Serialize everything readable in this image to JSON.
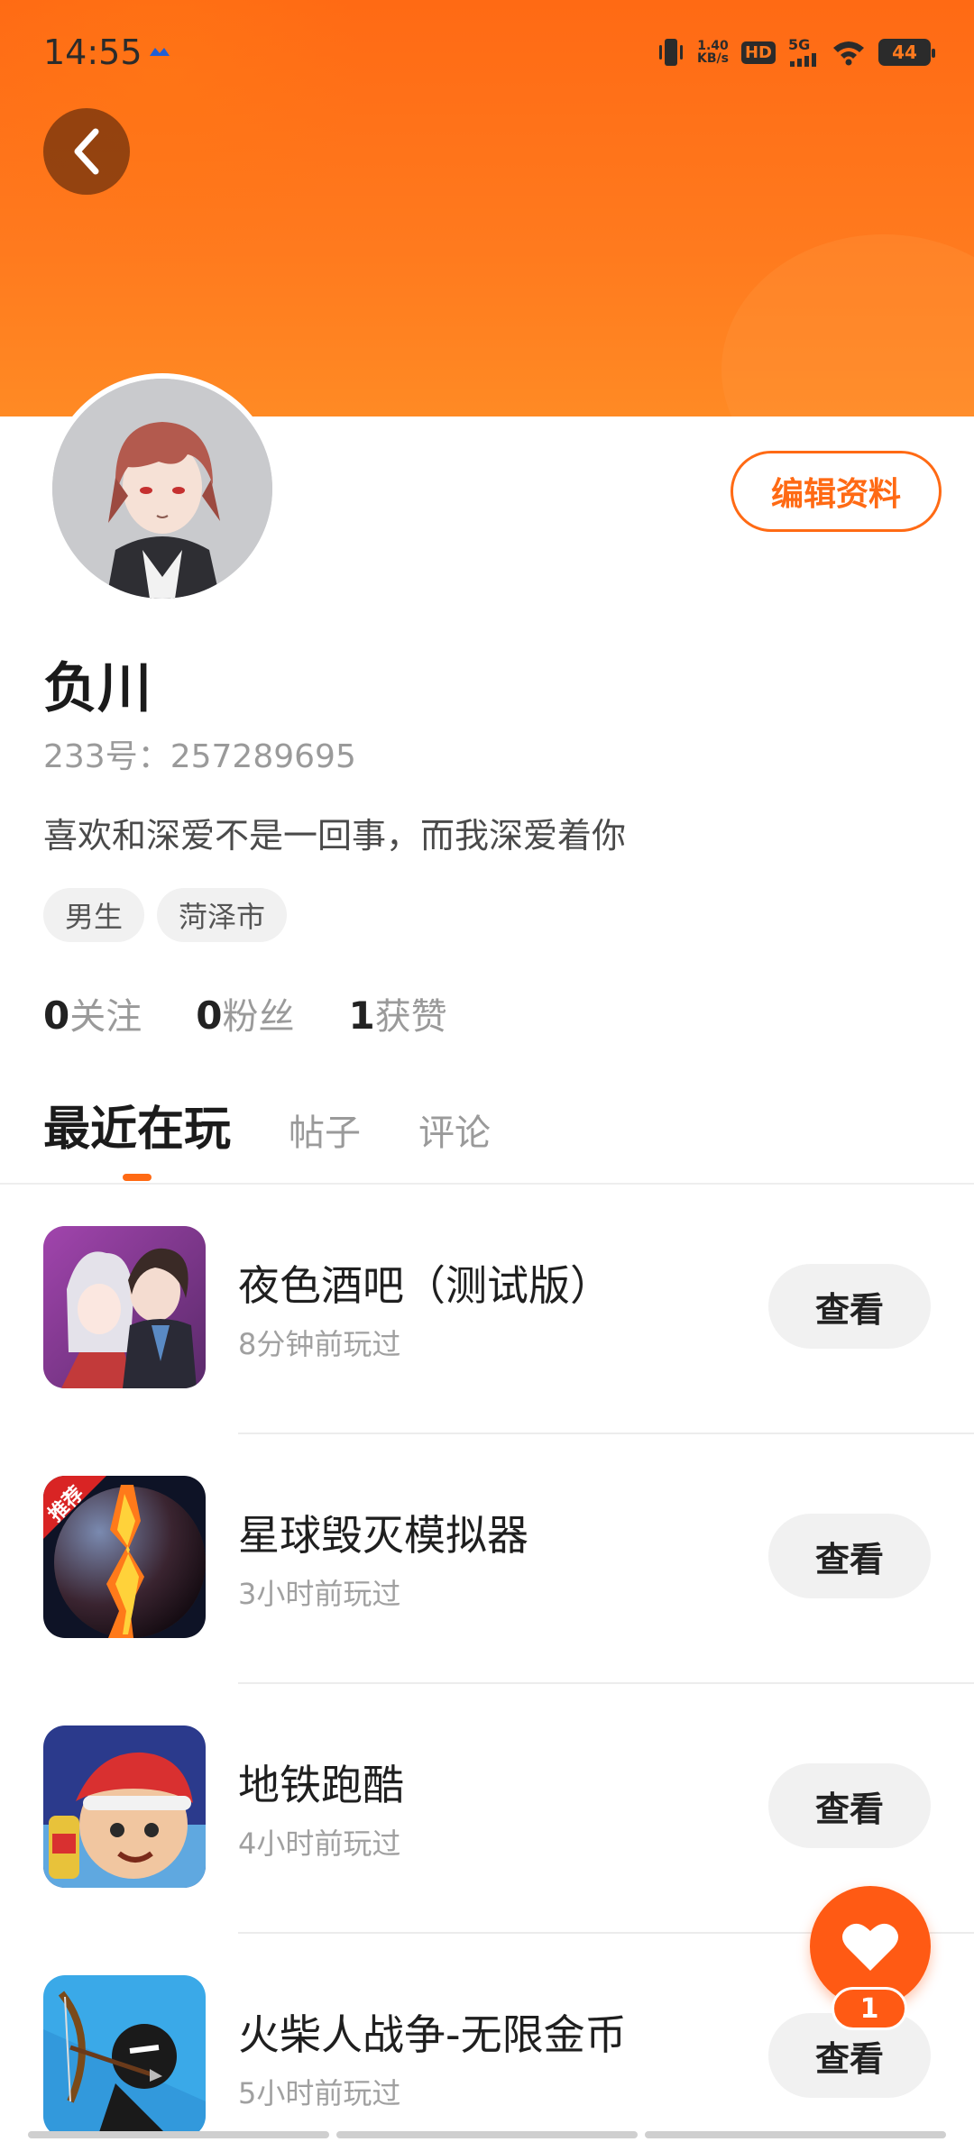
{
  "status_bar": {
    "time": "14:55",
    "speed_value": "1.40",
    "speed_unit": "KB/s",
    "hd_label": "HD",
    "network": "5G",
    "battery": "44"
  },
  "profile": {
    "username": "负川",
    "uid_text": "233号：257289695",
    "bio": "喜欢和深爱不是一回事，而我深爱着你",
    "tags": [
      "男生",
      "菏泽市"
    ],
    "edit_label": "编辑资料",
    "stats": [
      {
        "num": "0",
        "label": "关注"
      },
      {
        "num": "0",
        "label": "粉丝"
      },
      {
        "num": "1",
        "label": "获赞"
      }
    ]
  },
  "tabs": [
    "最近在玩",
    "帖子",
    "评论"
  ],
  "games": [
    {
      "title": "夜色酒吧（测试版）",
      "sub": "8分钟前玩过",
      "button": "查看"
    },
    {
      "title": "星球毁灭模拟器",
      "sub": "3小时前玩过",
      "button": "查看",
      "badge": "推荐"
    },
    {
      "title": "地铁跑酷",
      "sub": "4小时前玩过",
      "button": "查看"
    },
    {
      "title": "火柴人战争-无限金币",
      "sub": "5小时前玩过",
      "button": "查看"
    }
  ],
  "fab": {
    "count": "1"
  },
  "colors": {
    "accent": "#ff6a14",
    "banner": "#ff7a1e"
  }
}
